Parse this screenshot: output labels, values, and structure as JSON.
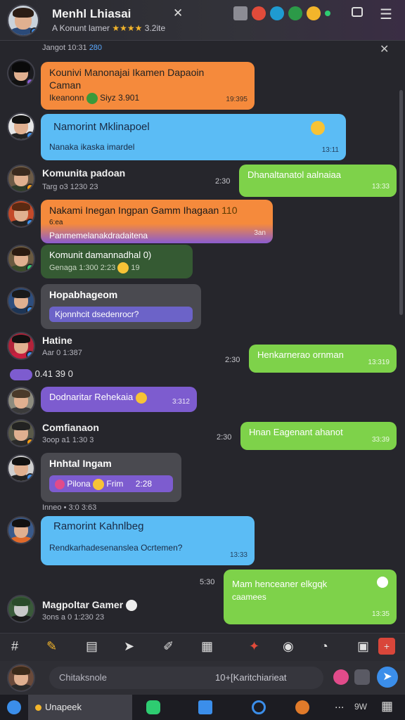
{
  "header": {
    "title": "Menhl Lhiasai",
    "subtitle": "A Konunt lamer",
    "rating_suffix": "3.2ite",
    "stars": "★★★★",
    "close": "✕",
    "menu": "☰"
  },
  "chat": {
    "top_meta_date": "Jangot 10:31",
    "top_meta_num": "280",
    "close": "✕",
    "messages": [
      {
        "id": "m1",
        "style": "orange",
        "title": "Kounivi Manonajai Ikamen Dapaoin",
        "sub": "Caman",
        "meta": "Ikeanonn",
        "extra": "Siyz 3.901",
        "time": "19:395"
      },
      {
        "id": "m2",
        "style": "blue",
        "title": "Namorint Mklinapoel",
        "body": "Nanaka ikaska imardel",
        "time": "13:11"
      },
      {
        "id": "m3",
        "style": "green",
        "sender": "Komunita padoan",
        "sender_meta": "Targ o3 1230 23",
        "title": "Dhanaltanatol aalnaiaa",
        "side_time": "2:30",
        "time": "13:33"
      },
      {
        "id": "m4",
        "style": "mix",
        "title": "Nakami Inegan Ingpan Gamm Ihagaan",
        "sub": "Panmemelanakdradaitena",
        "meta": "6:ea",
        "count": "110",
        "time": "3an"
      },
      {
        "id": "m5",
        "style": "darkgreen",
        "title": "Komunit damannadhal 0)",
        "meta": "Genaga 1:300 2:23",
        "count": "19"
      },
      {
        "id": "m6",
        "style": "gray",
        "title": "Hopabhageom",
        "body": "Kjonnhcit dsedenrocr?"
      },
      {
        "id": "m7",
        "style": "green",
        "sender": "Hatine",
        "sender_meta": "Aar 0 1:387",
        "inline": "0.41",
        "inline2": "39 0",
        "title": "Henkarnerao ornman",
        "side_time": "2:30",
        "time": "13:319"
      },
      {
        "id": "m8",
        "style": "purple",
        "title": "Dodnaritar Rehekaia",
        "time": "3:312"
      },
      {
        "id": "m9",
        "style": "green",
        "sender": "Comfianaon",
        "sender_meta": "3oop a1 1:30 3",
        "title": "Hnan Eagenant ahanot",
        "side_time": "2:30",
        "time": "33:39"
      },
      {
        "id": "m10",
        "style": "gray",
        "title": "Hnhtal Ingam",
        "body": "Pilona",
        "body2": "Frim",
        "body3": "2:28",
        "meta": "Inneo • 3:0 3:63"
      },
      {
        "id": "m11",
        "style": "blue",
        "title": "Ramorint Kahnlbeg",
        "body": "Rendkarhadesenanslea Ocrtemen?",
        "time": "13:33"
      },
      {
        "id": "m12",
        "style": "green",
        "title": "Mam henceaner elkgqk",
        "sub": "caamees",
        "side_time": "5:30",
        "time": "13:35"
      },
      {
        "id": "m13",
        "sender": "Magpoltar Gamer",
        "sender_meta": "3ons a 0 1:230 23"
      }
    ]
  },
  "composer": {
    "placeholder": "Chitaksnole",
    "right_text": "10+[Karitchiarieat"
  },
  "taskbar": {
    "active_label": "Unapeek",
    "more": "...",
    "extra": "9W"
  },
  "colors": {
    "orange": "#f58a3c",
    "blue": "#5bbcf5",
    "green": "#7ed24a",
    "purple": "#7d5ccf",
    "accent": "#3b8eea"
  }
}
